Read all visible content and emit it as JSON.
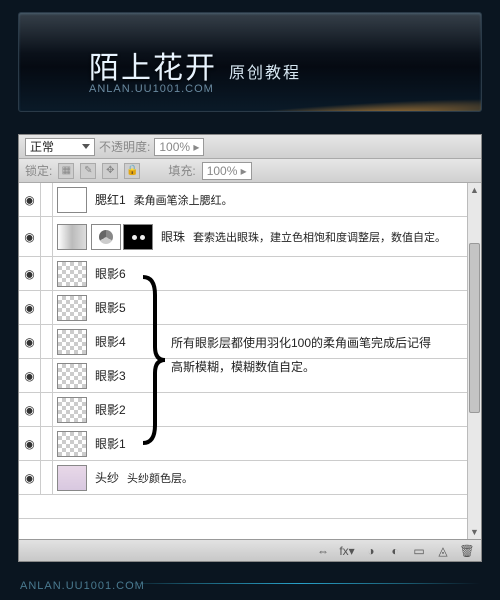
{
  "banner": {
    "title": "陌上花开",
    "subtitle": "原创教程",
    "url": "ANLAN.UU1001.COM"
  },
  "options": {
    "blend": "正常",
    "opacity_label": "不透明度:",
    "opacity": "100%",
    "lock_label": "锁定:",
    "fill_label": "填充:",
    "fill": "100%"
  },
  "layers": [
    {
      "name": "腮红1",
      "desc": "柔角画笔涂上腮红。",
      "thumb": "white",
      "vis": "◉"
    },
    {
      "name": "眼珠",
      "desc": "套索选出眼珠，建立色相饱和度调整层，数值自定。",
      "thumb": "adj",
      "vis": "◉"
    },
    {
      "name": "眼影6",
      "thumb": "checker",
      "vis": "◉"
    },
    {
      "name": "眼影5",
      "thumb": "checker",
      "vis": "◉"
    },
    {
      "name": "眼影4",
      "thumb": "checker",
      "vis": "◉"
    },
    {
      "name": "眼影3",
      "thumb": "checker",
      "vis": "◉"
    },
    {
      "name": "眼影2",
      "thumb": "checker",
      "vis": "◉"
    },
    {
      "name": "眼影1",
      "thumb": "checker",
      "vis": "◉"
    },
    {
      "name": "头纱",
      "desc": "头纱颜色层。",
      "thumb": "tousha",
      "vis": "◉"
    }
  ],
  "note": {
    "line1": "所有眼影层都使用羽化100的柔角画笔完成后记得",
    "line2": "高斯模糊，模糊数值自定。"
  },
  "status_icons": [
    "⇔",
    "fx▾",
    "◑",
    "◐",
    "▭",
    "◬",
    "⧉",
    "🗑"
  ],
  "footer_url": "ANLAN.UU1001.COM"
}
